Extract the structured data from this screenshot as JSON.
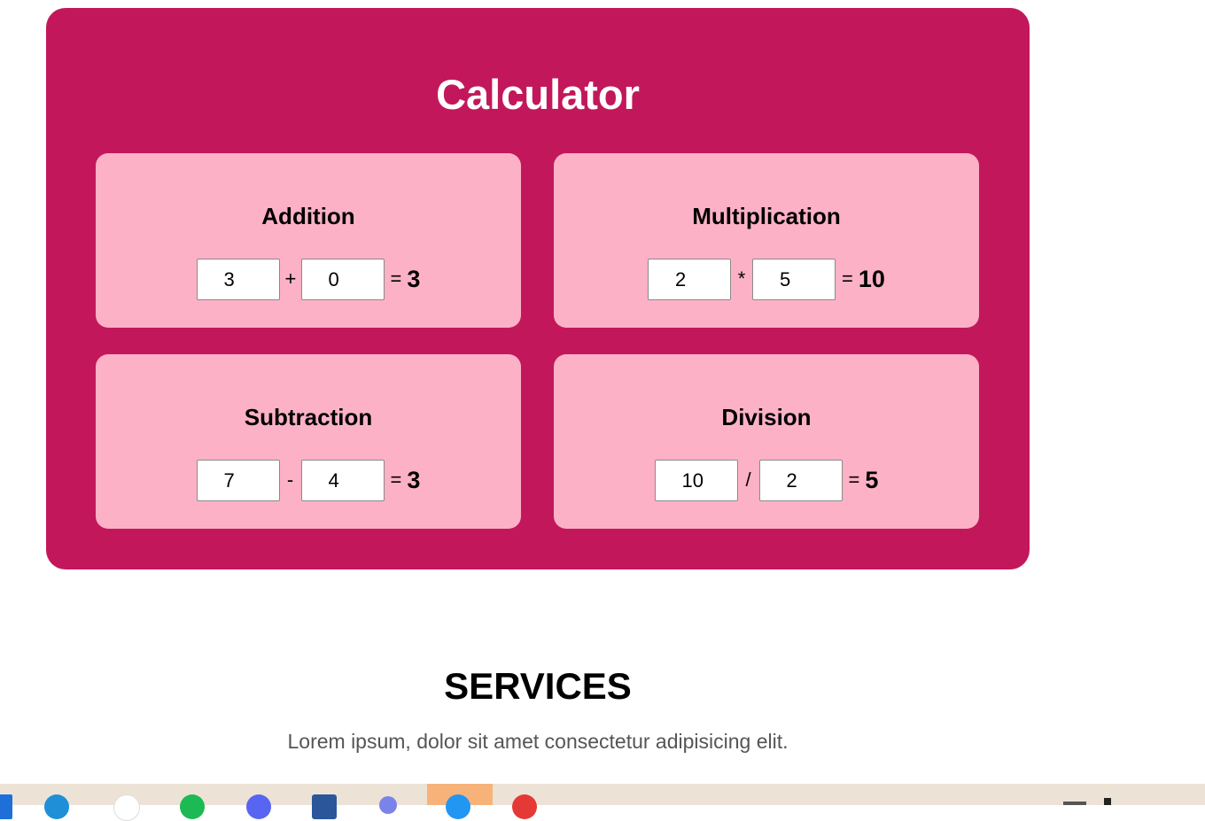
{
  "calculator": {
    "title": "Calculator",
    "cards": [
      {
        "title": "Addition",
        "a": "3",
        "op": "+",
        "b": "0",
        "eq": "=",
        "result": "3"
      },
      {
        "title": "Multiplication",
        "a": "2",
        "op": "*",
        "b": "5",
        "eq": "=",
        "result": "10"
      },
      {
        "title": "Subtraction",
        "a": "7",
        "op": "-",
        "b": "4",
        "eq": "=",
        "result": "3"
      },
      {
        "title": "Division",
        "a": "10",
        "op": "/",
        "b": "2",
        "eq": "=",
        "result": "5"
      }
    ]
  },
  "services": {
    "heading": "SERVICES",
    "text": "Lorem ipsum, dolor sit amet consectetur adipisicing elit."
  },
  "colors": {
    "panel": "#c2185b",
    "card": "#fdb1c7",
    "taskbar": "#ece3d6"
  },
  "taskbar": {
    "icons": [
      "windows-icon",
      "edge-icon",
      "chrome-icon",
      "spotify-icon",
      "discord-icon",
      "word-icon",
      "teams-icon",
      "app-icon",
      "photos-icon"
    ]
  }
}
